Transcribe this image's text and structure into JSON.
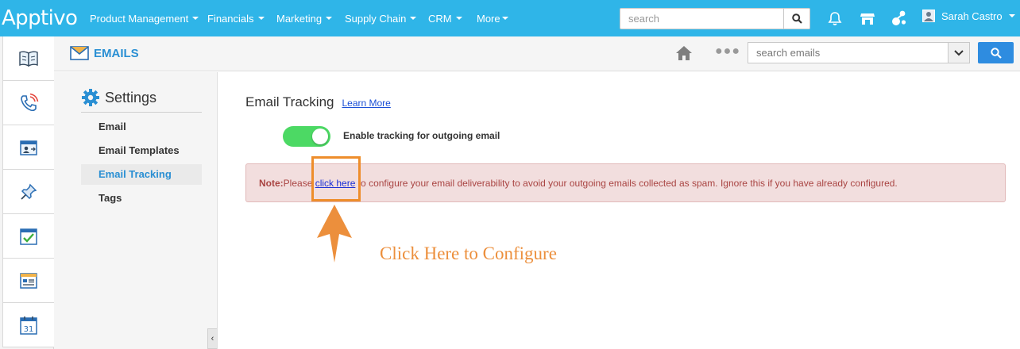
{
  "brand": {
    "logo_text": "Apptivo"
  },
  "top_nav": {
    "items": [
      {
        "label": "Product Management"
      },
      {
        "label": "Financials"
      },
      {
        "label": "Marketing"
      },
      {
        "label": "Supply Chain"
      },
      {
        "label": "CRM"
      },
      {
        "label": "More"
      }
    ],
    "search_placeholder": "search",
    "icons": [
      "bell-icon",
      "store-icon",
      "apps-icon"
    ],
    "user_name": "Sarah Castro"
  },
  "rail": {
    "icons": [
      "book-icon",
      "phone-icon",
      "contact-card-icon",
      "pin-icon",
      "checklist-icon",
      "form-icon",
      "calendar-icon"
    ],
    "calendar_day": "31"
  },
  "app_bar": {
    "title": "EMAILS",
    "search_placeholder": "search emails"
  },
  "sidebar": {
    "heading": "Settings",
    "items": [
      {
        "label": "Email",
        "active": false
      },
      {
        "label": "Email Templates",
        "active": false
      },
      {
        "label": "Email Tracking",
        "active": true
      },
      {
        "label": "Tags",
        "active": false
      }
    ],
    "collapse_glyph": "‹"
  },
  "main": {
    "title": "Email Tracking",
    "learn_more": "Learn More",
    "toggle": {
      "label": "Enable tracking for outgoing email",
      "on": true
    },
    "note": {
      "prefix": "Note:",
      "before": "Please ",
      "link": "click here",
      "after": " to configure your email deliverability to avoid your outgoing emails collected as spam. Ignore this if you have already configured."
    }
  },
  "annotation": {
    "callout": "Click Here to Configure",
    "color": "#ec8f3c"
  },
  "colors": {
    "topbar": "#2fb5e8",
    "accent": "#2a8fd3",
    "toggle_on": "#4cd964",
    "note_bg": "#f2dede",
    "note_text": "#a94442"
  }
}
